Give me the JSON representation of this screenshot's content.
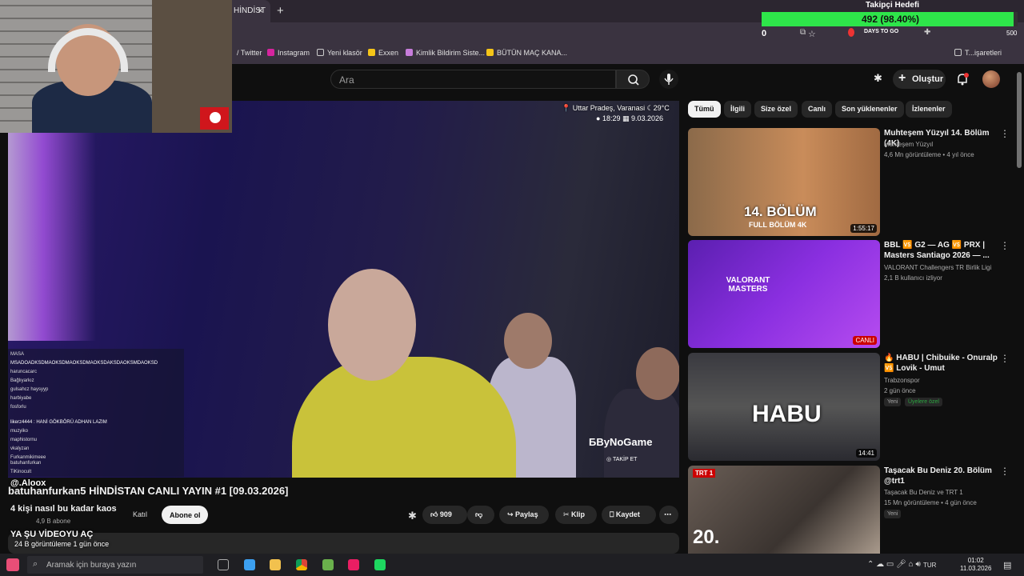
{
  "browser": {
    "tab_title": "HİNDİST",
    "tab_close": "×",
    "new_tab": "+",
    "bookmarks": [
      "Twitter",
      "Instagram",
      "Yeni klasör",
      "Exxen",
      "Kimlik Bildirim Siste...",
      "BÜTÜN MAÇ KANA...",
      "T...işaretleri"
    ],
    "days_to_go": "DAYS TO GO"
  },
  "follower_goal": {
    "title": "Takipçi Hedefi",
    "value_text": "492 (98.40%)",
    "progress": 0.984,
    "min_label": "0",
    "max_label": "500"
  },
  "header": {
    "search_placeholder": "Ara",
    "create_label": "Oluştur"
  },
  "video": {
    "location": "Uttar Pradeş, Varanasi",
    "temperature": "29°C",
    "time": "18:29",
    "date": "9.03.2026",
    "brand": "ByNoGame",
    "takip": "TAKİP ET",
    "title": "batuhanfurkan5 HİNDİSTAN CANLI YAYIN #1 [09.03.2026]"
  },
  "channel": {
    "name": "4 kişi nasıl bu kadar kaos",
    "subs": "4,9 B abone",
    "join": "Katıl",
    "subscribe": "Abone ol"
  },
  "actions": {
    "likes": "909",
    "share": "Paylaş",
    "clip": "Klip",
    "save": "Kaydet",
    "more": "⋯"
  },
  "overlay": {
    "line1": "@.Aloox",
    "line2": "YA ŞU VİDEOYU AÇ",
    "line3": "24 B görüntüleme  1 gün önce"
  },
  "chat": [
    "MASA",
    "MSADOADKSDMAOKSDMAOKSDMAOKSDAKSDAOKSMDAOKSD",
    "haruncacarc",
    "Bağlıyarkız",
    "gulsahcz   haysyyp",
    "harbiyabe",
    "fosforlu",
    "likerz4444 : HANİ GÖKBÖRÜ ADHAN LAZIM",
    "muzyiko",
    "maphistornu",
    "vkalyzan",
    "Furkanmikimeee",
    "batuhanfurkan",
    "TiKinocult"
  ],
  "chips": [
    "Tümü",
    "İlgili",
    "Size özel",
    "Canlı",
    "Son yüklenenler",
    "İzlenenler"
  ],
  "recommendations": [
    {
      "title": "Muhteşem Yüzyıl 14. Bölüm (4K)",
      "channel": "Muhteşem Yüzyıl",
      "meta": "4,6 Mn görüntüleme • 4 yıl önce",
      "duration": "1:55:17",
      "badge": "",
      "thumb_text": "14. BÖLÜM",
      "thumb_sub": "FULL BÖLÜM 4K"
    },
    {
      "title": "BBL  🆚 G2 — AG 🆚 PRX | Masters Santiago  2026 — ...",
      "channel": "VALORANT Challengers TR Birlik Ligi",
      "meta": "2,1 B kullanıcı izliyor",
      "duration": "CANLI",
      "badge": "",
      "thumb_text": "VALORANT MASTERS",
      "thumb_sub": ""
    },
    {
      "title": "🔥 HABU | Chibuike - Onuralp 🆚 Lovik - Umut",
      "channel": "Trabzonspor",
      "meta": "2 gün önce",
      "duration": "14:41",
      "badge": "Yeni",
      "badge2": "Üyelere özel",
      "thumb_text": "HABU",
      "thumb_sub": ""
    },
    {
      "title": "Taşacak Bu Deniz 20. Bölüm @trt1",
      "channel": "Taşacak Bu Deniz ve TRT 1",
      "meta": "15 Mn görüntüleme • 4 gün önce",
      "duration": "",
      "badge": "Yeni",
      "thumb_text": "20.",
      "thumb_sub": "TRT 1"
    }
  ],
  "taskbar": {
    "search_placeholder": "Aramak için buraya yazın",
    "lang": "TUR",
    "time": "01:02",
    "date": "11.03.2026"
  }
}
